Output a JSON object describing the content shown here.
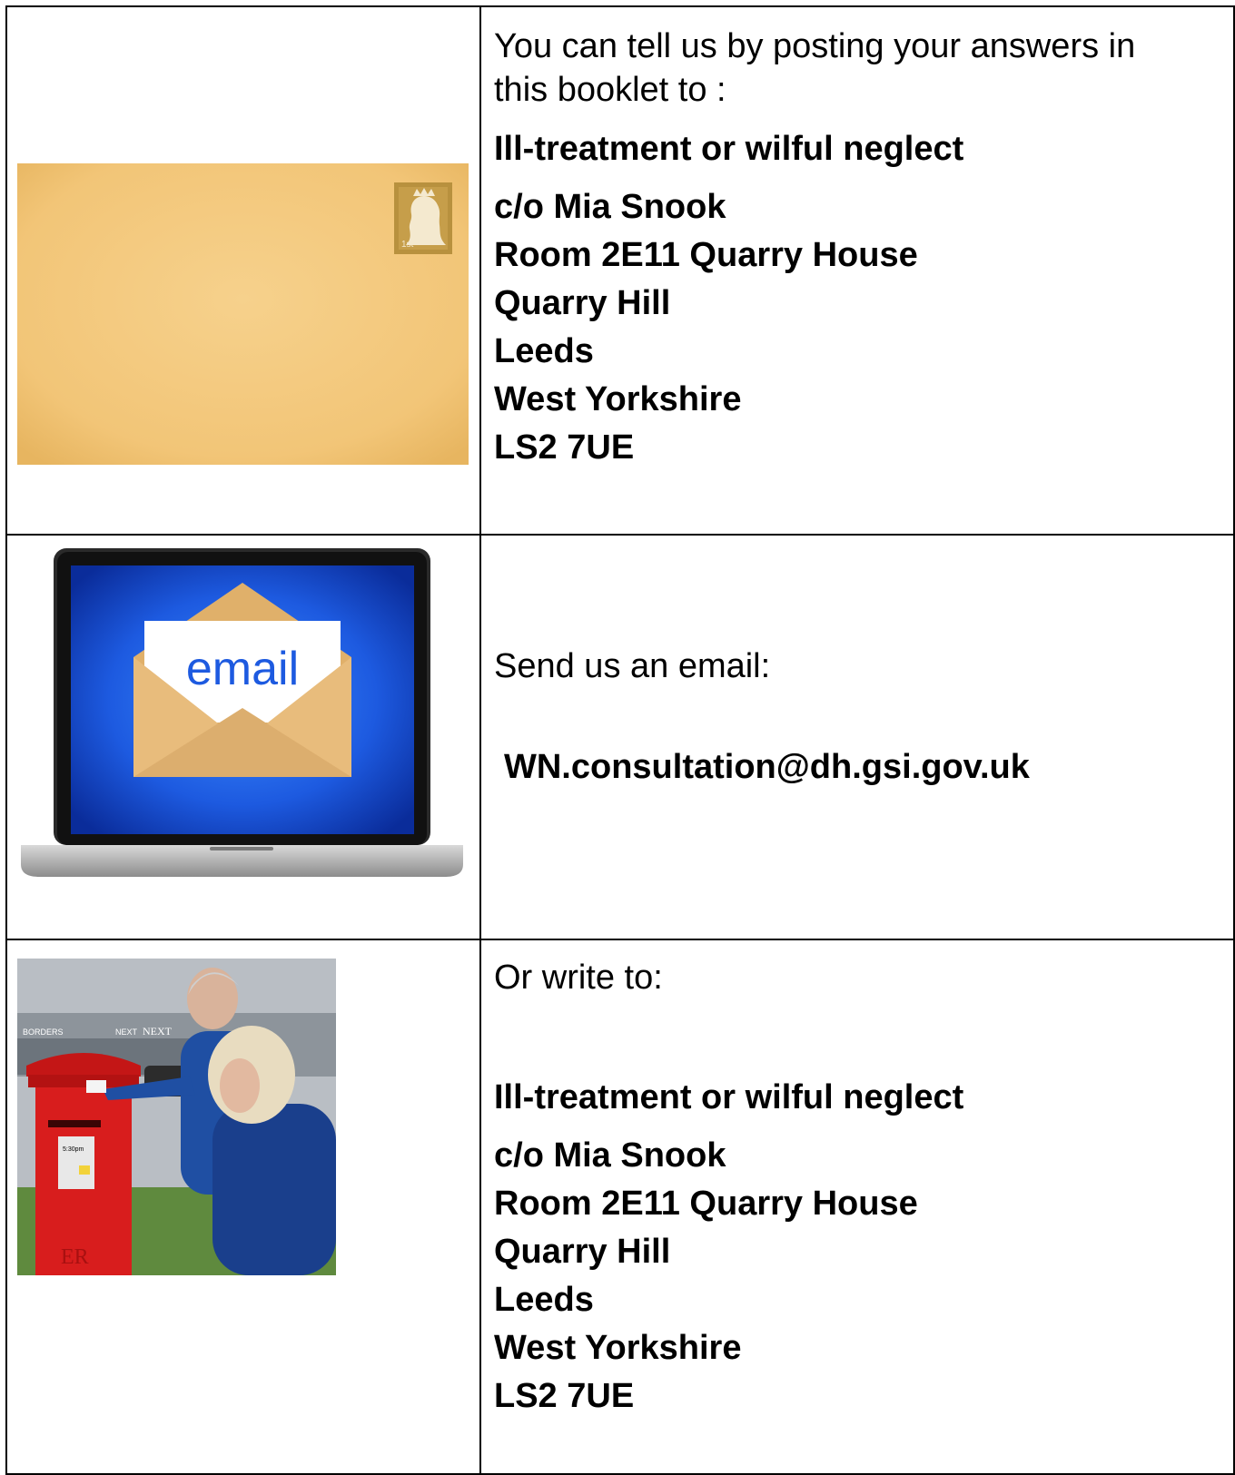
{
  "row1": {
    "intro": [
      "You can tell us by posting your answers in",
      "this booklet to :"
    ],
    "heading": "Ill-treatment or wilful neglect",
    "address": [
      "c/o Mia Snook",
      "Room 2E11 Quarry House",
      "Quarry Hill",
      "Leeds",
      "West Yorkshire",
      "LS2 7UE"
    ],
    "stamp_text": "1st"
  },
  "row2": {
    "intro": "Send us an email:",
    "email": "WN.consultation@dh.gsi.gov.uk",
    "screen_word": "email"
  },
  "row3": {
    "intro": "Or write to:",
    "heading": "Ill-treatment or wilful neglect",
    "address": [
      "c/o Mia Snook",
      "Room 2E11 Quarry House",
      "Quarry Hill",
      "Leeds",
      "West Yorkshire",
      "LS2 7UE"
    ],
    "shop_signs": [
      "BORDERS",
      "NEXT",
      "NEXT"
    ],
    "postbox_cypher": "ER",
    "postbox_time": "5:30pm"
  },
  "colors": {
    "envelope": "#f3c77a",
    "stamp": "#b8913e",
    "postbox_red": "#d81d1d",
    "screen_blue": "#1f5fe0"
  }
}
